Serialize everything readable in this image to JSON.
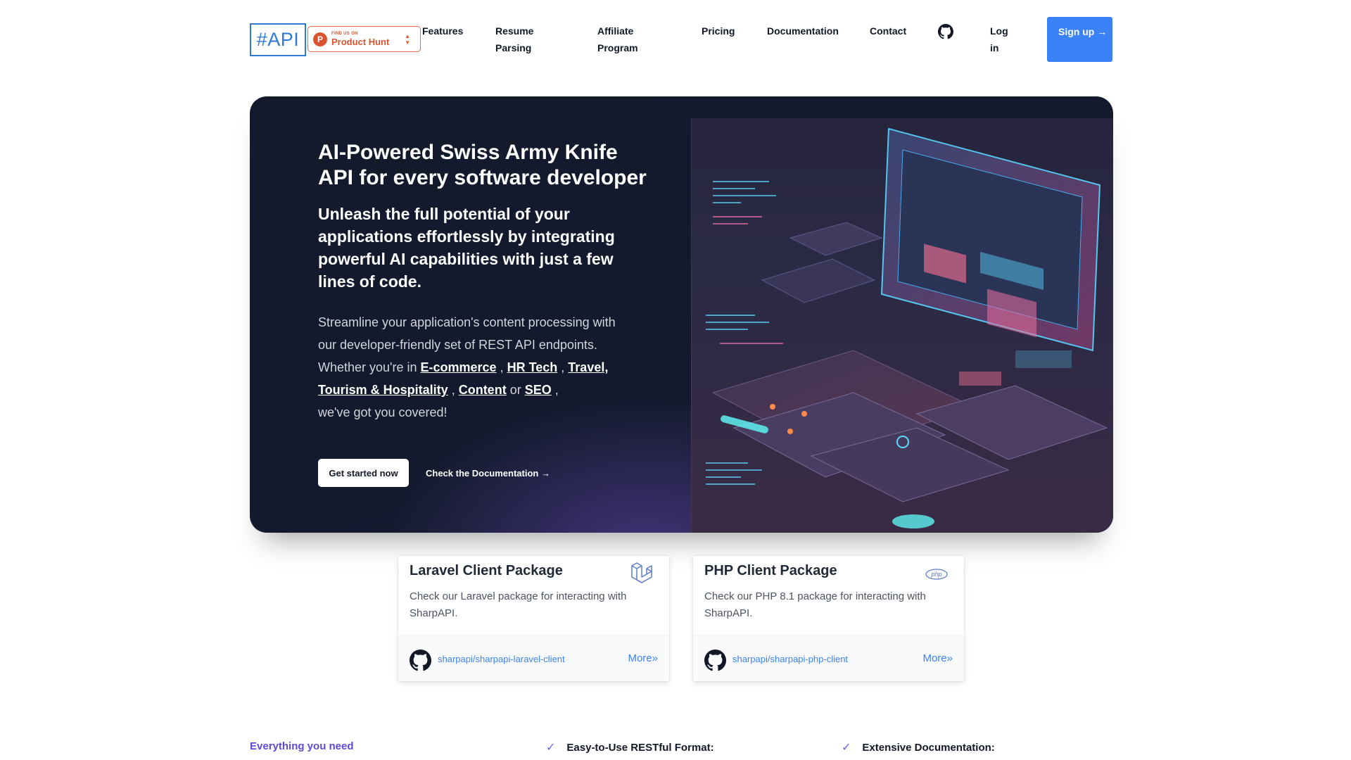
{
  "header": {
    "logo": "#API",
    "product_hunt": {
      "small": "FIND US ON",
      "name": "Product Hunt"
    },
    "nav": [
      {
        "label": "Features"
      },
      {
        "label": "Resume Parsing"
      },
      {
        "label": "Affiliate Program"
      },
      {
        "label": "Pricing"
      },
      {
        "label": "Documentation"
      },
      {
        "label": "Contact"
      }
    ],
    "github_icon": "github-icon",
    "login": "Log in",
    "signup": "Sign up →"
  },
  "hero": {
    "title": "AI-Powered Swiss Army Knife API for every software developer",
    "subtitle": "Unleash the full potential of your applications effortlessly by integrating powerful AI capabilities with just a few lines of code.",
    "body_intro": "Streamline your application's content processing with our developer-friendly set of REST API endpoints. Whether you're in ",
    "links": [
      "E-commerce",
      "HR Tech",
      "Travel, Tourism & Hospitality",
      "Content",
      "SEO"
    ],
    "body_or": " or ",
    "body_outro": "we've got you covered!",
    "cta_primary": "Get started now",
    "cta_secondary": "Check the Documentation →"
  },
  "cards": [
    {
      "title": "Laravel Client Package",
      "desc": "Check our Laravel package for interacting with SharpAPI.",
      "repo": "sharpapi/sharpapi-laravel-client",
      "more": "More»",
      "icon": "laravel-icon"
    },
    {
      "title": "PHP Client Package",
      "desc": "Check our PHP 8.1 package for interacting with SharpAPI.",
      "repo": "sharpapi/sharpapi-php-client",
      "more": "More»",
      "icon": "php-icon",
      "icon_text": "php"
    }
  ],
  "features": {
    "eyebrow": "Everything you need",
    "items": [
      "Easy-to-Use RESTful Format:",
      "Extensive Documentation:"
    ]
  },
  "colors": {
    "primary": "#3b82f6",
    "hero_bg": "#121a2c",
    "product_hunt": "#da552f",
    "accent_purple": "#5b4bd6"
  }
}
